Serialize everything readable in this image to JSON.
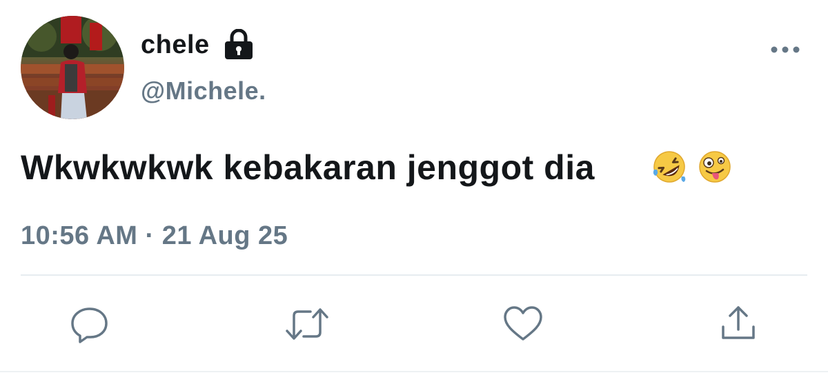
{
  "user": {
    "display_name": "chele",
    "handle": "@Michele.",
    "protected_icon": "lock-icon"
  },
  "tweet": {
    "text": "Wkwkwkwk kebakaran jenggot dia",
    "emojis": [
      "rolling-on-floor-laughing",
      "zany-face"
    ],
    "timestamp": "10:56 AM · 21 Aug 25"
  },
  "menu": {
    "icon": "more-horizontal-icon"
  },
  "actions": [
    {
      "name": "reply",
      "icon": "reply-icon"
    },
    {
      "name": "retweet",
      "icon": "retweet-icon"
    },
    {
      "name": "like",
      "icon": "heart-icon"
    },
    {
      "name": "share",
      "icon": "share-icon"
    }
  ],
  "colors": {
    "text_primary": "#14171a",
    "text_secondary": "#657786",
    "icon": "#657786",
    "divider": "#e6ecf0"
  }
}
